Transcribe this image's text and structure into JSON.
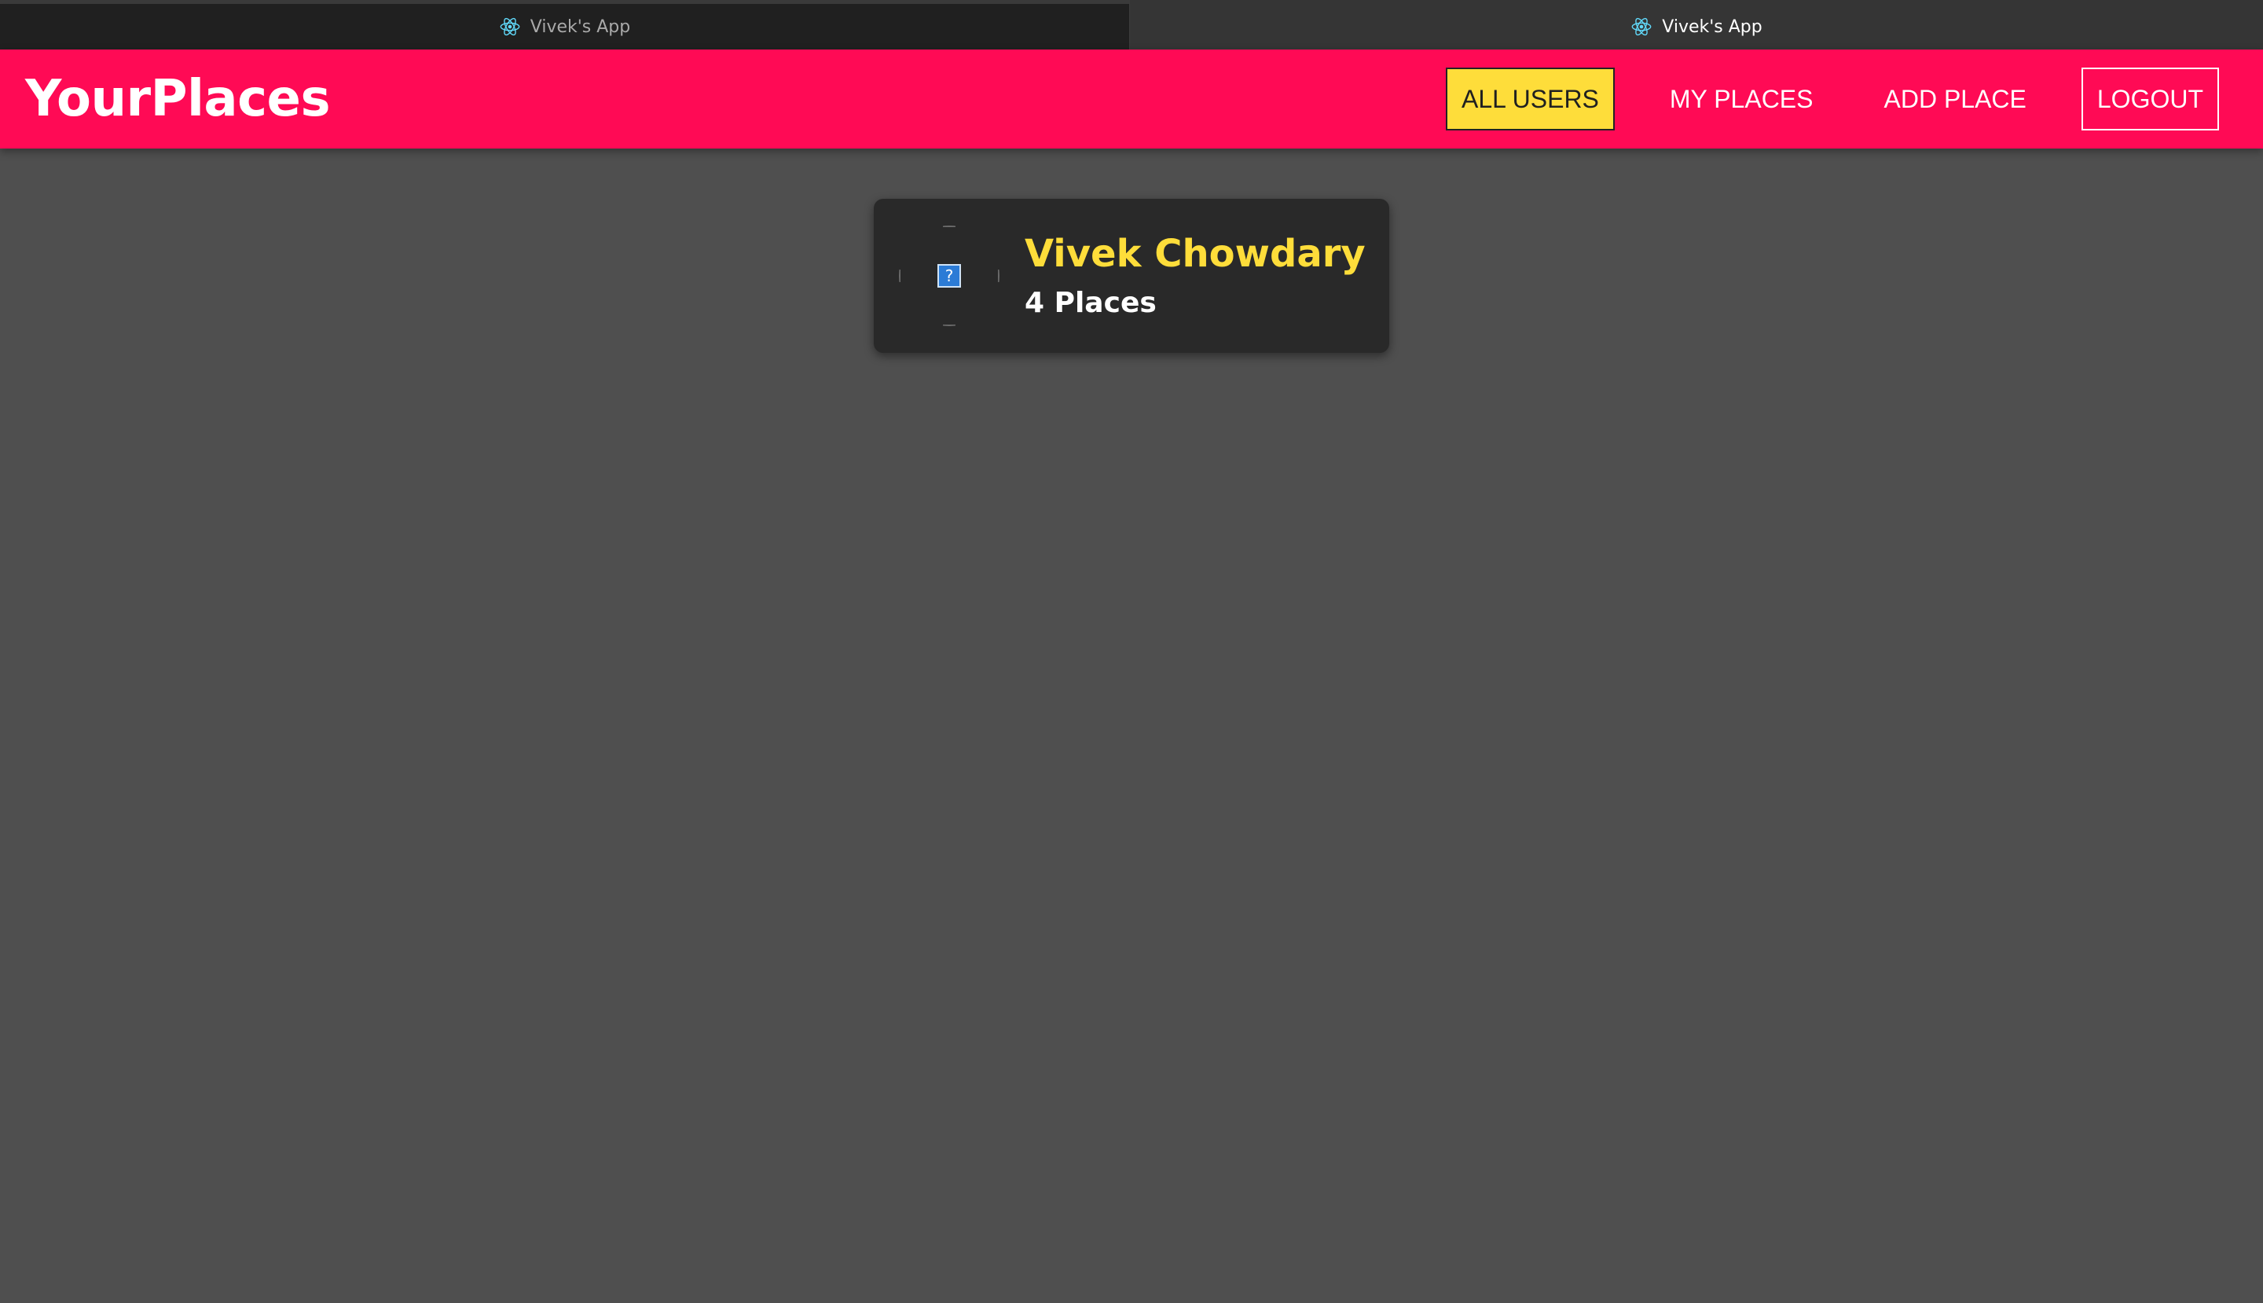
{
  "browser": {
    "tabs": [
      {
        "title": "Vivek's App",
        "icon": "react-icon",
        "active": false
      },
      {
        "title": "Vivek's App",
        "icon": "react-icon",
        "active": true
      }
    ]
  },
  "header": {
    "brand": "YourPlaces",
    "nav": {
      "all_users": "ALL USERS",
      "my_places": "MY PLACES",
      "add_place": "ADD PLACE",
      "logout": "LOGOUT"
    },
    "active_item": "all_users"
  },
  "users": [
    {
      "name": "Vivek Chowdary",
      "places_label": "4 Places",
      "avatar": "broken-image-icon",
      "avatar_glyph": "?"
    }
  ],
  "colors": {
    "header_bg": "#ff0a55",
    "accent_yellow": "#fedd3a",
    "page_bg": "#4f4f4f",
    "card_bg": "#292929",
    "react_blue": "#61dafb"
  }
}
